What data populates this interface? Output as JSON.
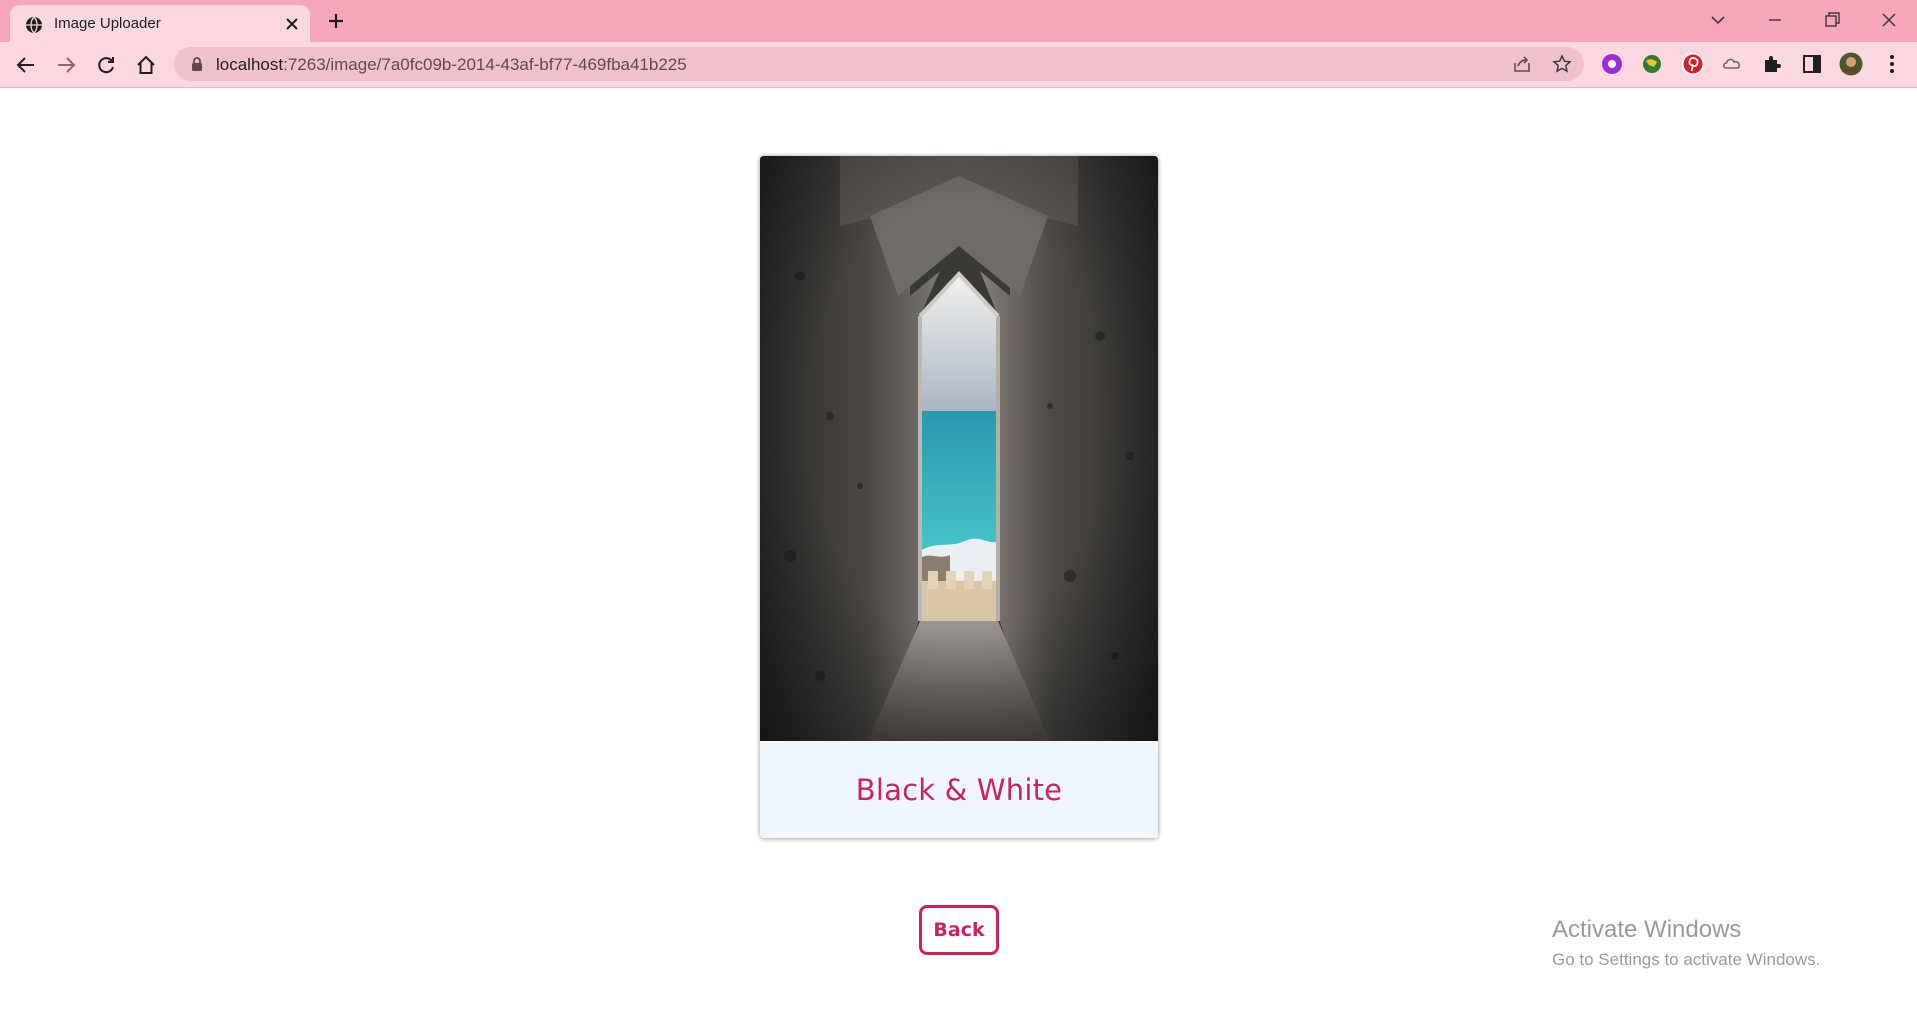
{
  "browser": {
    "tab": {
      "title": "Image Uploader"
    },
    "address_bar": {
      "host": "localhost",
      "path": ":7263/image/7a0fc09b-2014-43af-bf77-469fba41b225"
    },
    "icons": {
      "favicon": "globe-icon",
      "close": "close-icon",
      "new_tab": "plus-icon",
      "tab_search": "chevron-down-icon",
      "minimize": "minimize-icon",
      "restore": "restore-icon",
      "window_close": "close-icon",
      "back": "arrow-left-icon",
      "forward": "arrow-right-icon",
      "reload": "reload-icon",
      "home": "home-icon",
      "lock": "lock-icon",
      "share": "share-icon",
      "bookmark": "star-icon",
      "extensions": [
        "purple-extension-icon",
        "globe-extension-icon",
        "pinterest-icon",
        "cloud-extension-icon",
        "puzzle-icon",
        "sidebar-icon",
        "avatar",
        "kebab-menu-icon"
      ]
    },
    "colors": {
      "tabstrip": "#f6a8ba",
      "toolbar": "#fbd7e0",
      "omnibox": "#efc1cc"
    }
  },
  "card": {
    "image_alt": "Stone window opening to the sea",
    "title": "Black & White",
    "accent": "#c9245e",
    "footer_bg": "#eff6fd"
  },
  "actions": {
    "back_label": "Back"
  },
  "watermark": {
    "title": "Activate Windows",
    "subtitle": "Go to Settings to activate Windows."
  }
}
